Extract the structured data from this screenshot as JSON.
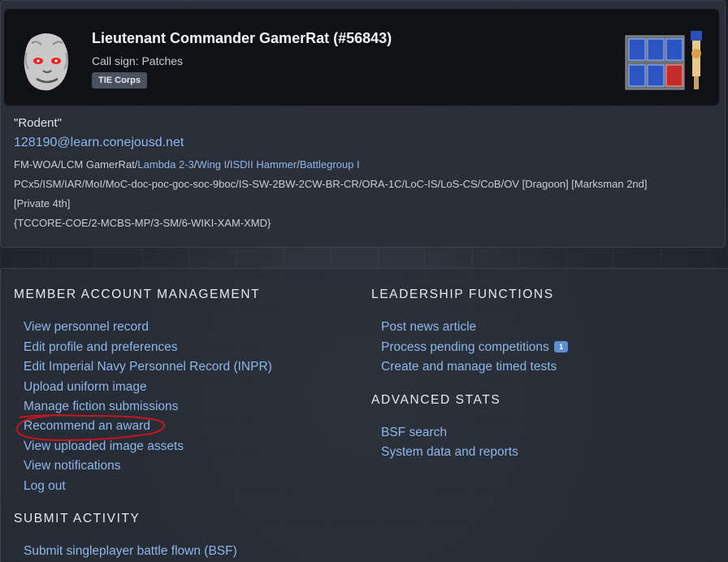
{
  "profile": {
    "rank": "Lieutenant Commander",
    "name": "GamerRat",
    "pin": "(#56843)",
    "callsign": "Call sign: Patches",
    "unit_badge": "TIE Corps",
    "nickname": "\"Rodent\"",
    "email": "128190@learn.conejousd.net",
    "position_prefix": "FM-WOA/LCM GamerRat/",
    "position_links": [
      "Lambda 2-3",
      "Wing I",
      "ISDII Hammer",
      "Battlegroup I"
    ],
    "awards_line_1": "PCx5/ISM/IAR/MoI/MoC-doc-poc-goc-soc-9boc/IS-SW-2BW-2CW-BR-CR/ORA-1C/LoC-IS/LoS-CS/CoB/OV [Dragoon] [Marksman 2nd]",
    "awards_line_2": "[Private 4th]",
    "training_line": "{TCCORE-COE/2-MCBS-MP/3-SM/6-WIKI-XAM-XMD}"
  },
  "member_account": {
    "title": "MEMBER ACCOUNT MANAGEMENT",
    "links": [
      "View personnel record",
      "Edit profile and preferences",
      "Edit Imperial Navy Personnel Record (INPR)",
      "Upload uniform image",
      "Manage fiction submissions",
      "Recommend an award",
      "View uploaded image assets",
      "View notifications",
      "Log out"
    ]
  },
  "submit_activity": {
    "title": "SUBMIT ACTIVITY",
    "links": [
      "Submit singleplayer battle flown (BSF)"
    ]
  },
  "leadership": {
    "title": "LEADERSHIP FUNCTIONS",
    "links": [
      "Post news article",
      "Process pending competitions",
      "Create and manage timed tests"
    ],
    "pending_count": "1"
  },
  "advanced_stats": {
    "title": "ADVANCED STATS",
    "links": [
      "BSF search",
      "System data and reports"
    ]
  },
  "colors": {
    "link": "#8fb6e8",
    "annotation": "#c8161d",
    "badge": "#5b8fd0"
  }
}
